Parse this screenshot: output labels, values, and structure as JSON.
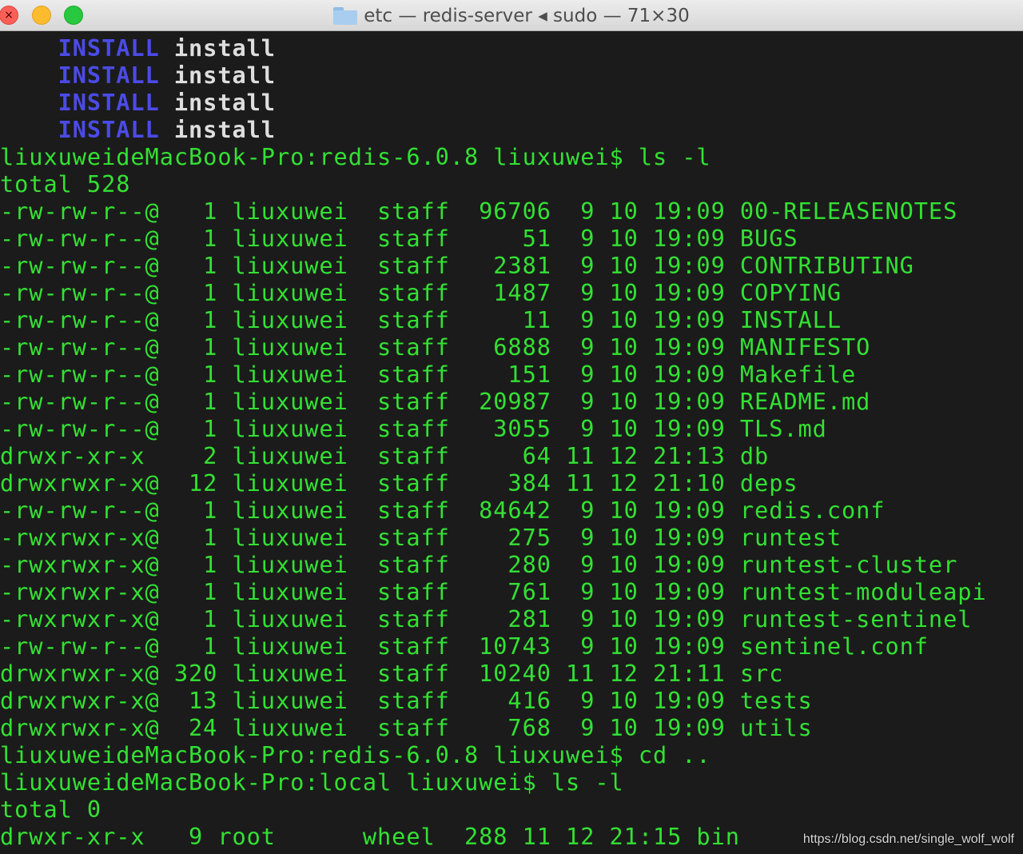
{
  "window": {
    "title": "etc — redis-server ◂ sudo — 71×30",
    "folder_icon": "folder-icon",
    "close_glyph": "×"
  },
  "terminal": {
    "install_lines": [
      {
        "indent": "    ",
        "keyword": "INSTALL",
        "sep": " ",
        "arg": "install"
      },
      {
        "indent": "    ",
        "keyword": "INSTALL",
        "sep": " ",
        "arg": "install"
      },
      {
        "indent": "    ",
        "keyword": "INSTALL",
        "sep": " ",
        "arg": "install"
      },
      {
        "indent": "    ",
        "keyword": "INSTALL",
        "sep": " ",
        "arg": "install"
      }
    ],
    "lines": [
      "liuxuweideMacBook-Pro:redis-6.0.8 liuxuwei$ ls -l",
      "total 528",
      "-rw-rw-r--@   1 liuxuwei  staff  96706  9 10 19:09 00-RELEASENOTES",
      "-rw-rw-r--@   1 liuxuwei  staff     51  9 10 19:09 BUGS",
      "-rw-rw-r--@   1 liuxuwei  staff   2381  9 10 19:09 CONTRIBUTING",
      "-rw-rw-r--@   1 liuxuwei  staff   1487  9 10 19:09 COPYING",
      "-rw-rw-r--@   1 liuxuwei  staff     11  9 10 19:09 INSTALL",
      "-rw-rw-r--@   1 liuxuwei  staff   6888  9 10 19:09 MANIFESTO",
      "-rw-rw-r--@   1 liuxuwei  staff    151  9 10 19:09 Makefile",
      "-rw-rw-r--@   1 liuxuwei  staff  20987  9 10 19:09 README.md",
      "-rw-rw-r--@   1 liuxuwei  staff   3055  9 10 19:09 TLS.md",
      "drwxr-xr-x    2 liuxuwei  staff     64 11 12 21:13 db",
      "drwxrwxr-x@  12 liuxuwei  staff    384 11 12 21:10 deps",
      "-rw-rw-r--@   1 liuxuwei  staff  84642  9 10 19:09 redis.conf",
      "-rwxrwxr-x@   1 liuxuwei  staff    275  9 10 19:09 runtest",
      "-rwxrwxr-x@   1 liuxuwei  staff    280  9 10 19:09 runtest-cluster",
      "-rwxrwxr-x@   1 liuxuwei  staff    761  9 10 19:09 runtest-moduleapi",
      "-rwxrwxr-x@   1 liuxuwei  staff    281  9 10 19:09 runtest-sentinel",
      "-rw-rw-r--@   1 liuxuwei  staff  10743  9 10 19:09 sentinel.conf",
      "drwxrwxr-x@ 320 liuxuwei  staff  10240 11 12 21:11 src",
      "drwxrwxr-x@  13 liuxuwei  staff    416  9 10 19:09 tests",
      "drwxrwxr-x@  24 liuxuwei  staff    768  9 10 19:09 utils",
      "liuxuweideMacBook-Pro:redis-6.0.8 liuxuwei$ cd ..",
      "liuxuweideMacBook-Pro:local liuxuwei$ ls -l",
      "total 0",
      "drwxr-xr-x   9 root      wheel  288 11 12 21:15 bin"
    ],
    "colors": {
      "background": "#1b1b1b",
      "text": "#33e133",
      "keyword": "#4b4be6",
      "argument": "#dedede"
    }
  },
  "watermark": "https://blog.csdn.net/single_wolf_wolf"
}
